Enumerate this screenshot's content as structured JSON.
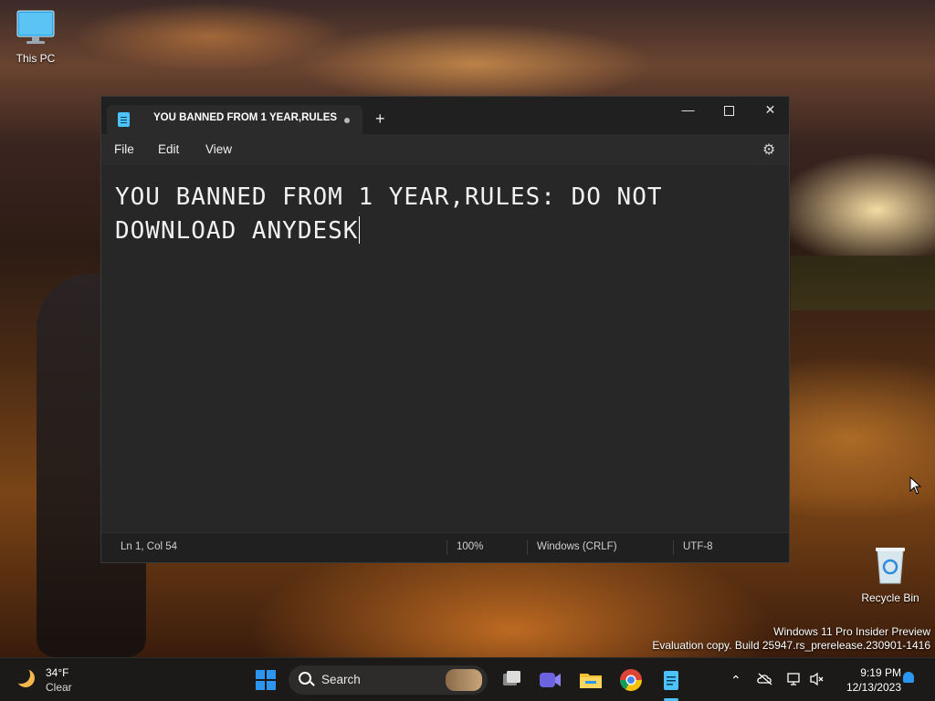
{
  "desktop": {
    "this_pc_label": "This PC",
    "recycle_bin_label": "Recycle Bin",
    "watermark_line1": "Windows 11 Pro Insider Preview",
    "watermark_line2": "Evaluation copy. Build 25947.rs_prerelease.230901-1416"
  },
  "notepad": {
    "tab_title": "YOU BANNED FROM 1 YEAR,RULES",
    "tab_unsaved": true,
    "new_tab_icon": "plus-icon",
    "menu": {
      "file": "File",
      "edit": "Edit",
      "view": "View"
    },
    "settings_icon": "gear-icon",
    "content": "YOU BANNED FROM 1 YEAR,RULES: DO NOT DOWNLOAD ANYDESK",
    "status": {
      "position": "Ln 1, Col 54",
      "zoom": "100%",
      "line_ending": "Windows (CRLF)",
      "encoding": "UTF-8"
    },
    "colors": {
      "accent": "#4cc2ff",
      "background": "#202020",
      "editor_background": "#272727"
    }
  },
  "taskbar": {
    "weather_temp": "34°F",
    "weather_condition": "Clear",
    "weather_icon": "moon-icon",
    "search_label": "Search",
    "apps": [
      "start-icon",
      "task-view-icon",
      "meet-icon",
      "file-explorer-icon",
      "chrome-icon",
      "notepad-icon"
    ],
    "time": "9:19 PM",
    "date": "12/13/2023"
  }
}
